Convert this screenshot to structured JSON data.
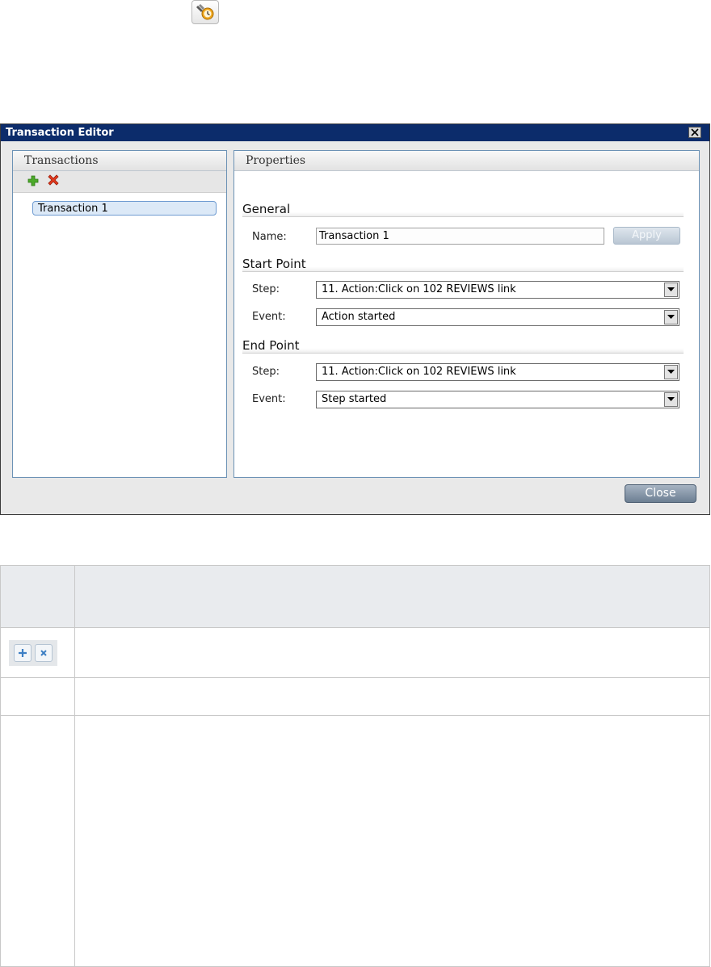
{
  "toolbar_icon": {
    "icon": "transaction-editor-icon"
  },
  "dialog": {
    "title": "Transaction Editor",
    "transactions_panel": {
      "header": "Transactions",
      "add_icon": "plus-icon",
      "delete_icon": "red-x-icon",
      "items": [
        {
          "label": "Transaction 1"
        }
      ]
    },
    "properties_panel": {
      "header": "Properties",
      "general": {
        "heading": "General",
        "name_label": "Name:",
        "name_value": "Transaction 1",
        "apply_label": "Apply"
      },
      "start_point": {
        "heading": "Start Point",
        "step_label": "Step:",
        "step_value": "11. Action:Click on 102 REVIEWS link",
        "event_label": "Event:",
        "event_value": "Action started"
      },
      "end_point": {
        "heading": "End Point",
        "step_label": "Step:",
        "step_value": "11. Action:Click on 102 REVIEWS link",
        "event_label": "Event:",
        "event_value": "Step started"
      }
    },
    "close_label": "Close"
  },
  "doc_table": {
    "row_icons": [
      "plus-icon",
      "x-icon"
    ]
  }
}
